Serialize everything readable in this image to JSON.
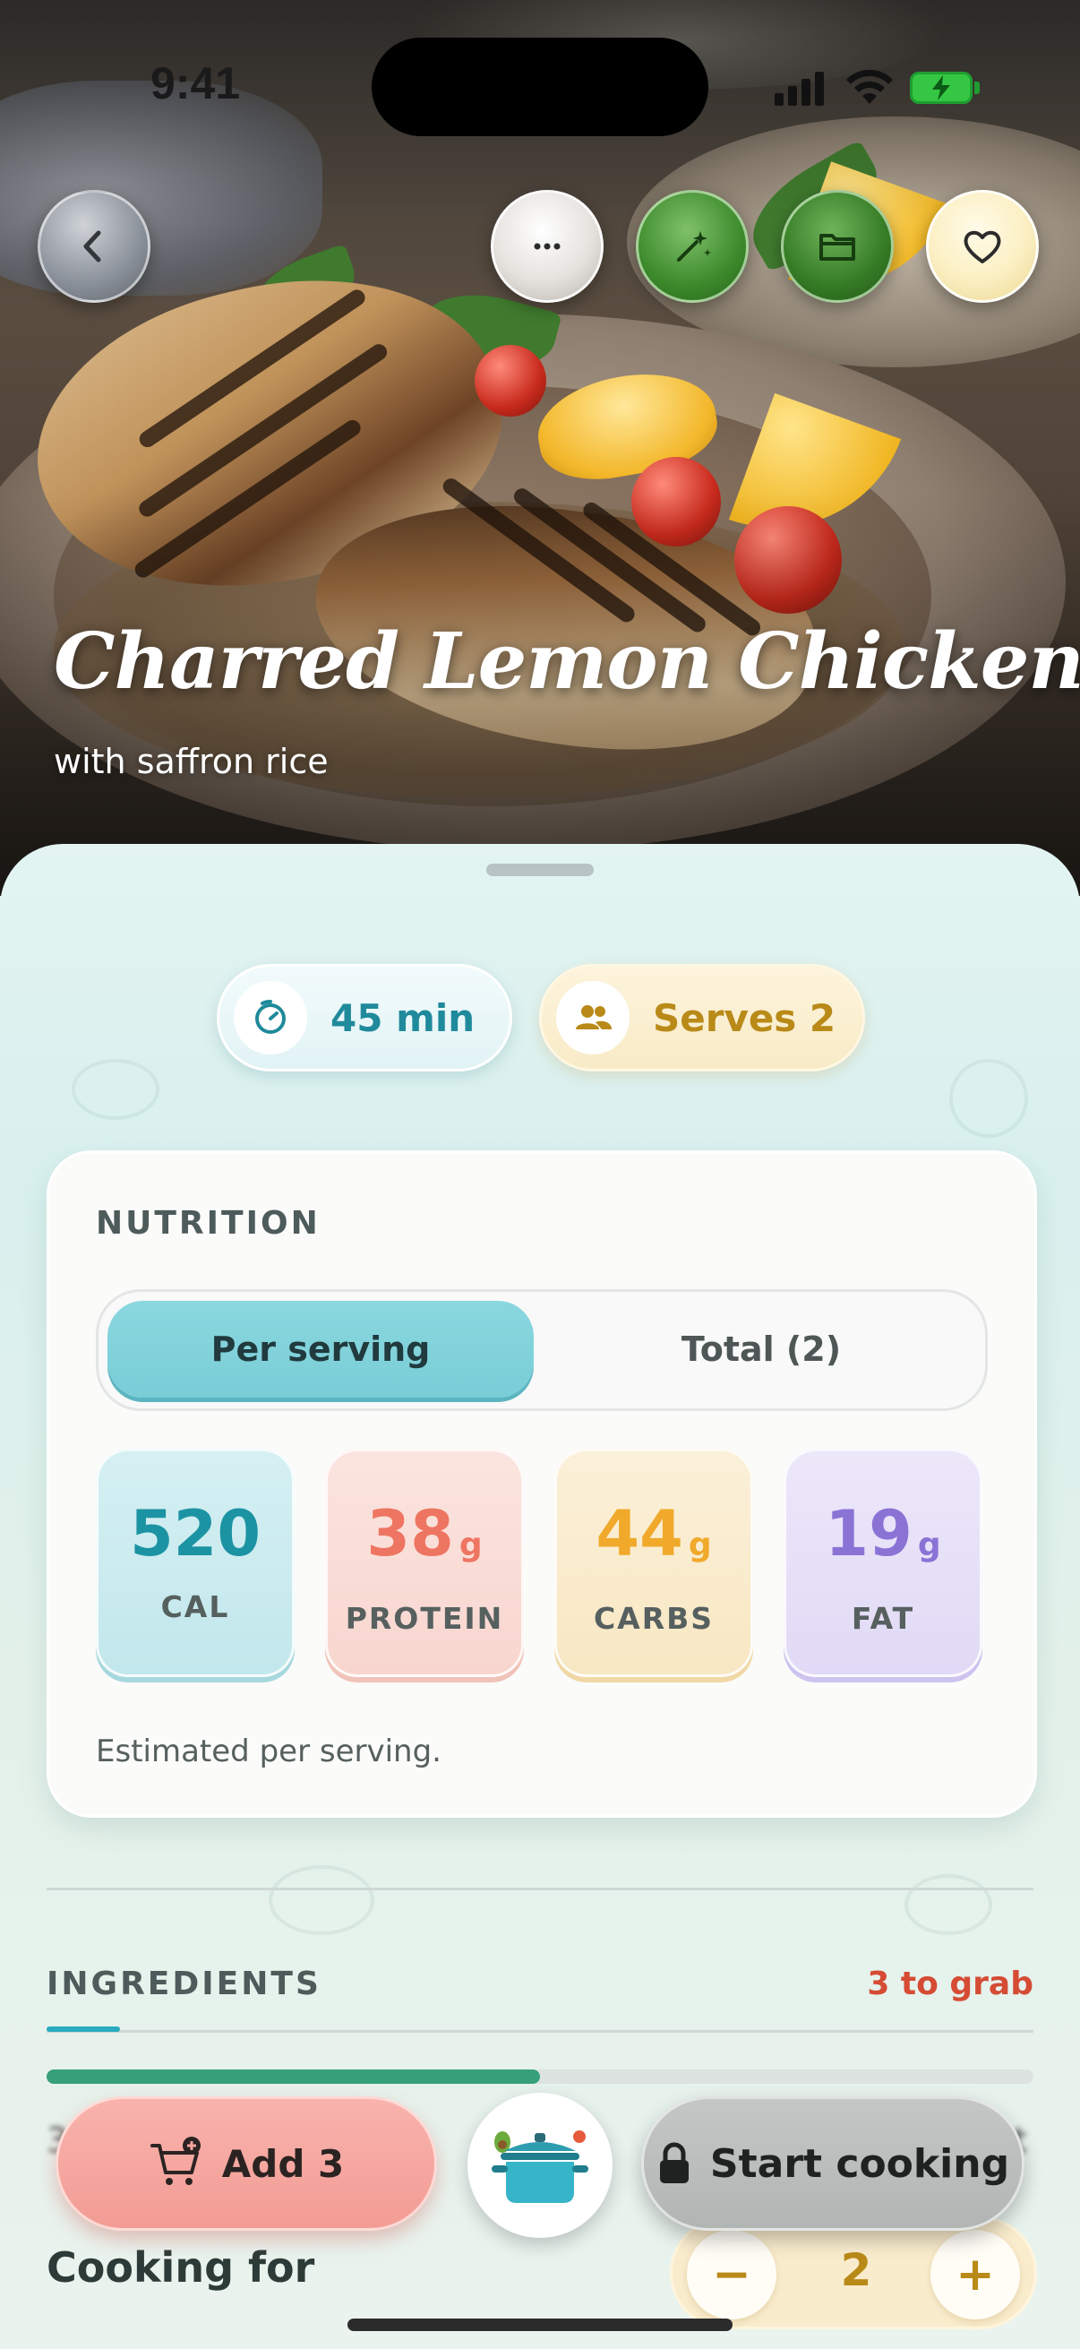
{
  "status_bar": {
    "time": "9:41"
  },
  "recipe": {
    "title": "Charred Lemon Chicken",
    "subtitle": "with saffron rice"
  },
  "header_buttons": {
    "back": "chevron-left-icon",
    "more": "ellipsis-icon",
    "magic": "magic-wand-icon",
    "folder": "folder-icon",
    "favorite": "heart-icon"
  },
  "meta": {
    "time_label": "45 min",
    "serves_label": "Serves 2"
  },
  "nutrition": {
    "heading": "NUTRITION",
    "tabs": [
      {
        "label": "Per serving",
        "active": true
      },
      {
        "label": "Total (2)",
        "active": false
      }
    ],
    "items": [
      {
        "value": "520",
        "unit": "",
        "label": "CAL",
        "color": "#1c93a3"
      },
      {
        "value": "38",
        "unit": "g",
        "label": "PROTEIN",
        "color": "#ee7562"
      },
      {
        "value": "44",
        "unit": "g",
        "label": "CARBS",
        "color": "#f0a92a"
      },
      {
        "value": "19",
        "unit": "g",
        "label": "FAT",
        "color": "#8b73d6"
      }
    ],
    "note": "Estimated per serving."
  },
  "ingredients": {
    "heading": "INGREDIENTS",
    "to_grab": "3 to grab",
    "progress_fraction": 0.5,
    "row_prefix": "3",
    "row_suffix": "t"
  },
  "cooking_for": {
    "label": "Cooking for",
    "value": "2",
    "minus": "−",
    "plus": "+"
  },
  "actions": {
    "add_label": "Add 3",
    "start_label": "Start cooking"
  },
  "colors": {
    "accent_teal": "#79cdd6",
    "accent_red": "#d54b34",
    "accent_gold": "#b98a18",
    "progress_green": "#36a07b"
  }
}
